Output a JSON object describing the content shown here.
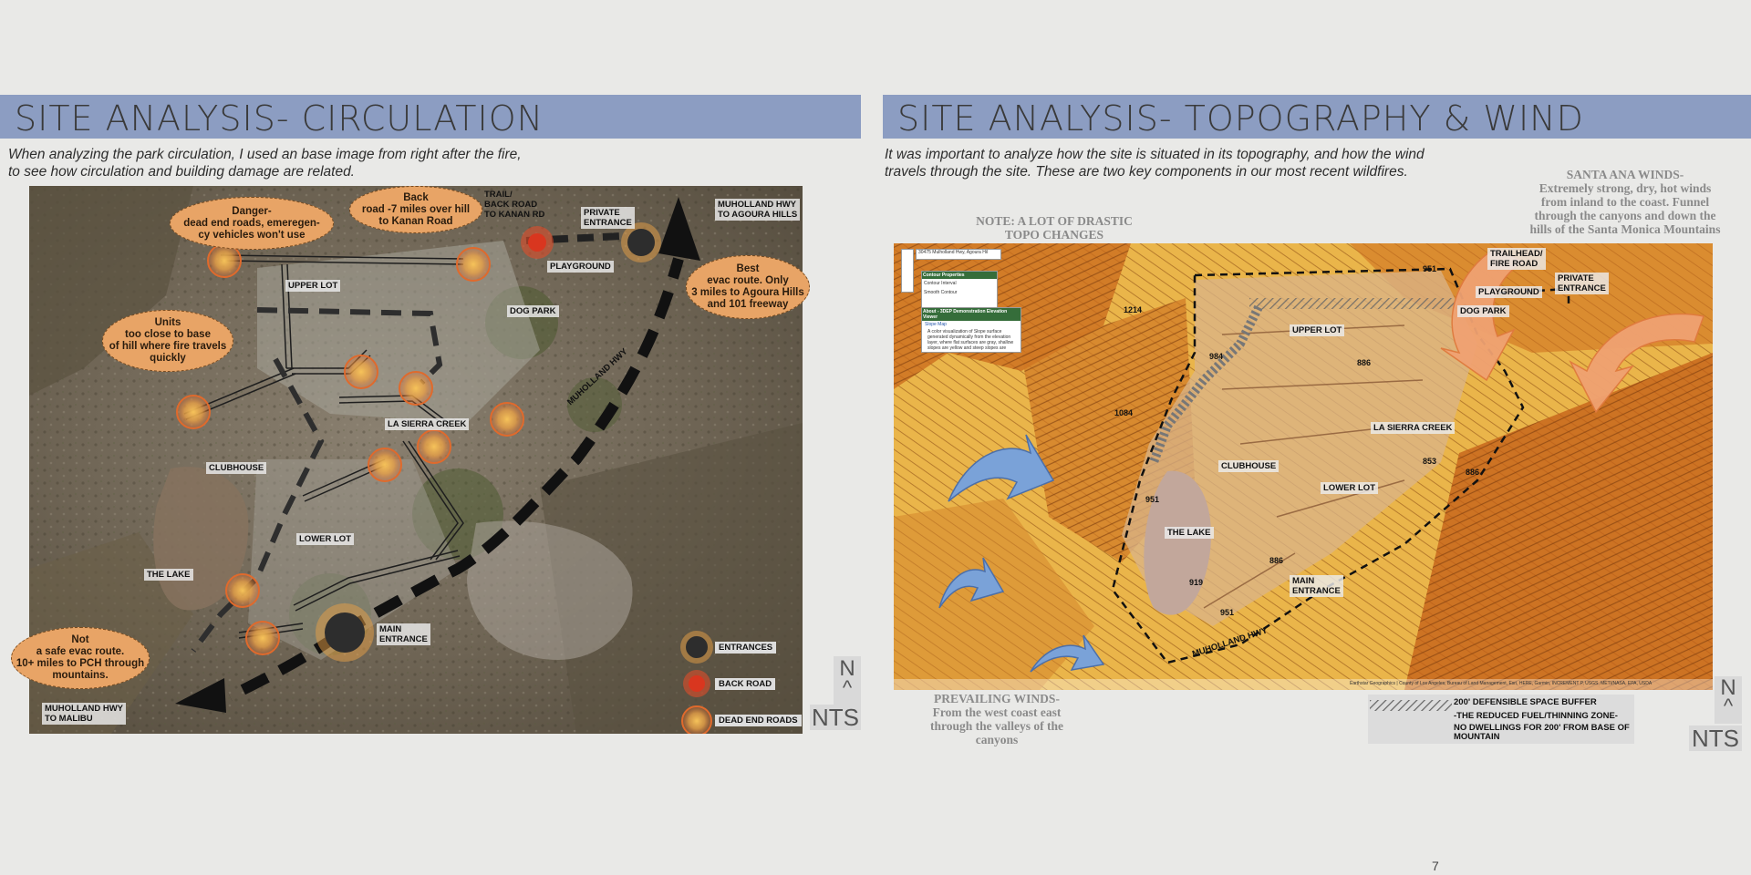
{
  "left": {
    "title": "SITE ANALYSIS- CIRCULATION",
    "intro": "When analyzing the park circulation, I used an base image from right after the fire,\nto see how circulation and building damage are related.",
    "map_labels": {
      "upper_lot": "UPPER LOT",
      "dog_park": "DOG PARK",
      "playground": "PLAYGROUND",
      "la_sierra_creek": "LA SIERRA CREEK",
      "clubhouse": "CLUBHOUSE",
      "lower_lot": "LOWER LOT",
      "the_lake": "THE LAKE",
      "main_entrance": "MAIN\nENTRANCE",
      "muholland_hwy": "MUHOLLAND HWY",
      "trail_back_road": "TRAIL/\nBACK ROAD\nTO KANAN RD",
      "private_entrance": "PRIVATE\nENTRANCE",
      "to_agoura": "MUHOLLAND HWY\nTO AGOURA HILLS",
      "to_malibu": "MUHOLLAND HWY\nTO MALIBU"
    },
    "notes": {
      "danger": "Danger-\ndead end roads, emeregen-\ncy vehicles won't use",
      "back_road": "Back\nroad -7 miles over hill\nto Kanan Road",
      "best": "Best\nevac route. Only\n3 miles to Agoura Hills\nand 101 freeway",
      "units": "Units\ntoo close to base\nof hill where fire travels\nquickly",
      "not_safe": "Not\na safe evac route.\n10+ miles to PCH through\nmountains."
    },
    "legend": {
      "entrances": "ENTRANCES",
      "back_road": "BACK ROAD",
      "dead_end": "DEAD END ROADS"
    },
    "north": "N",
    "nts": "NTS"
  },
  "right": {
    "title": "SITE ANALYSIS- TOPOGRAPHY & WIND",
    "intro": "It was important to analyze how the site is situated in its topography, and how the wind\ntravels through the site. These are two key components in our most recent wildfires.",
    "note_topo": "NOTE: A LOT OF DRASTIC\nTOPO CHANGES",
    "santa_ana": "SANTA ANA WINDS-\nExtremely strong, dry, hot winds\nfrom inland to the coast. Funnel\nthrough the canyons and down the\nhills of the Santa Monica Mountains",
    "prevailing": "PREVAILING WINDS-\nFrom the west coast east\nthrough the valleys of the\ncanyons",
    "map_labels": {
      "trailhead": "TRAILHEAD/\nFIRE ROAD",
      "private_entrance": "PRIVATE\nENTRANCE",
      "playground": "PLAYGROUND",
      "dog_park": "DOG PARK",
      "upper_lot": "UPPER LOT",
      "la_sierra_creek": "LA SIERRA CREEK",
      "clubhouse": "CLUBHOUSE",
      "lower_lot": "LOWER LOT",
      "the_lake": "THE LAKE",
      "main_entrance": "MAIN\nENTRANCE",
      "muholland_hwy": "MUHOLLAND HWY"
    },
    "elevations": [
      "1214",
      "984",
      "886",
      "1084",
      "853",
      "886",
      "951",
      "886",
      "919",
      "951",
      "951"
    ],
    "widget": {
      "search": "30475 Mulholland Hwy, Agoura Hil",
      "contour_title": "Contour Properties",
      "contour_interval": "Contour Interval",
      "smooth": "Smooth Contour",
      "about": "About - 3DEP Demonstration Elevation Viewer",
      "layer": "Slope Map",
      "desc": "A color visualization of Slope surface generated dynamically from the elevation layer, where flat surfaces are gray, shallow slopes are yellow and steep slopes are orange."
    },
    "attribution": "Earthstar Geographics | County of Los Angeles, Bureau of Land Management, Esri, HERE, Garmin, INCREMENT P, USGS, METI/NASA, EPA, USDA",
    "legend": {
      "line1": "200' DEFENSIBLE SPACE BUFFER",
      "line2": "-THE REDUCED FUEL/THINNING ZONE-",
      "line3": "NO DWELLINGS FOR 200' FROM BASE OF\nMOUNTAIN"
    },
    "north": "N",
    "nts": "NTS"
  },
  "page_number": "7",
  "colors": {
    "header_band": "#8c9dc2",
    "note_fill": "#e8a466",
    "page_bg": "#e9e9e7"
  }
}
